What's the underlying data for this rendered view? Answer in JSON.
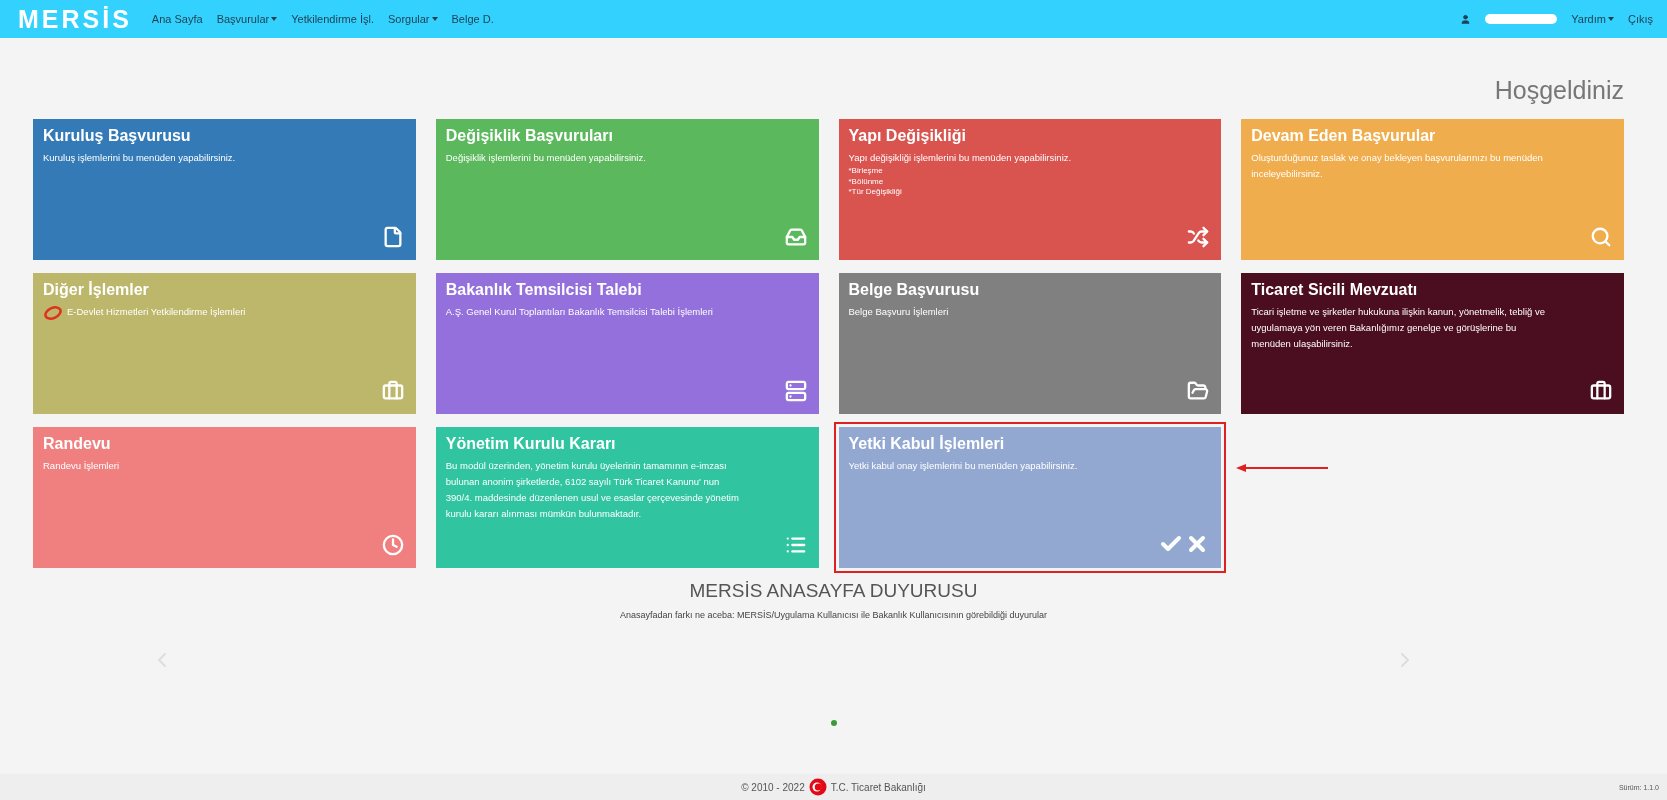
{
  "navbar": {
    "logo": "MERSİS",
    "items": [
      {
        "label": "Ana Sayfa",
        "has_menu": false
      },
      {
        "label": "Başvurular",
        "has_menu": true
      },
      {
        "label": "Yetkilendirme İşl.",
        "has_menu": false
      },
      {
        "label": "Sorgular",
        "has_menu": true
      },
      {
        "label": "Belge D.",
        "has_menu": false
      }
    ],
    "right_items": [
      {
        "label": "Yardım",
        "has_menu": true
      },
      {
        "label": "Çıkış",
        "has_menu": false
      }
    ]
  },
  "welcome": "Hoşgeldiniz",
  "tiles": [
    {
      "title": "Kuruluş Başvurusu",
      "description": "Kuruluş işlemlerini bu menüden yapabilirsiniz.",
      "color": "#337ab7",
      "highlighted": false
    },
    {
      "title": "Değişiklik Başvuruları",
      "description": "Değişiklik işlemlerini bu menüden yapabilirsiniz.",
      "color": "#5cb85c",
      "highlighted": false
    },
    {
      "title": "Yapı Değişikliği",
      "description": "Yapı değişikliği işlemlerini bu menüden yapabilirsiniz.",
      "notes": [
        "*Birleşme",
        "*Bölünme",
        "*Tür Değişikliği"
      ],
      "color": "#d9534f",
      "highlighted": false
    },
    {
      "title": "Devam Eden Başvurular",
      "description": "Oluşturduğunuz taslak ve onay bekleyen başvurularınızı bu menüden inceleyebilirsiniz.",
      "color": "#f0ad4e",
      "highlighted": false
    },
    {
      "title": "Diğer İşlemler",
      "description": "E-Devlet Hizmetleri Yetkilendirme İşlemleri",
      "has_logo": true,
      "color": "#bdb76b",
      "highlighted": false
    },
    {
      "title": "Bakanlık Temsilcisi Talebi",
      "description": "A.Ş. Genel Kurul Toplantıları Bakanlık Temsilcisi Talebi İşlemleri",
      "color": "#9370db",
      "highlighted": false
    },
    {
      "title": "Belge Başvurusu",
      "description": "Belge Başvuru İşlemleri",
      "color": "#808080",
      "highlighted": false
    },
    {
      "title": "Ticaret Sicili Mevzuatı",
      "description": "Ticari işletme ve şirketler hukukuna ilişkin kanun, yönetmelik, tebliğ ve uygulamaya yön veren Bakanlığımız genelge ve görüşlerine bu menüden ulaşabilirsiniz.",
      "color": "#4b0d20",
      "highlighted": false
    },
    {
      "title": "Randevu",
      "description": "Randevu İşlemleri",
      "color": "#f08080",
      "highlighted": false
    },
    {
      "title": "Yönetim Kurulu Kararı",
      "description": "Bu modül üzerinden, yönetim kurulu üyelerinin tamamının e-imzası bulunan anonim şirketlerde, 6102 sayılı Türk Ticaret Kanunu' nun 390/4. maddesinde düzenlenen usul ve esaslar çerçevesinde yönetim kurulu kararı alınması mümkün bulunmaktadır.",
      "color": "#30c5a0",
      "highlighted": false
    },
    {
      "title": "Yetki Kabul İşlemleri",
      "description": "Yetki kabul onay işlemlerini bu menüden yapabilirsiniz.",
      "color": "#92a8d1",
      "highlighted": true
    }
  ],
  "announcement": {
    "title": "MERSİS ANASAYFA DUYURUSU",
    "text": "Anasayfadan farkı ne aceba: MERSİS/Uygulama Kullanıcısı ile Bakanlık Kullanıcısının görebildiği duyurular",
    "dots": [
      {
        "selected": true
      }
    ]
  },
  "footer": {
    "copyright": "© 2010 - 2022",
    "ministry": "T.C. Ticaret Bakanlığı",
    "version": "Sürüm: 1.1.0"
  }
}
